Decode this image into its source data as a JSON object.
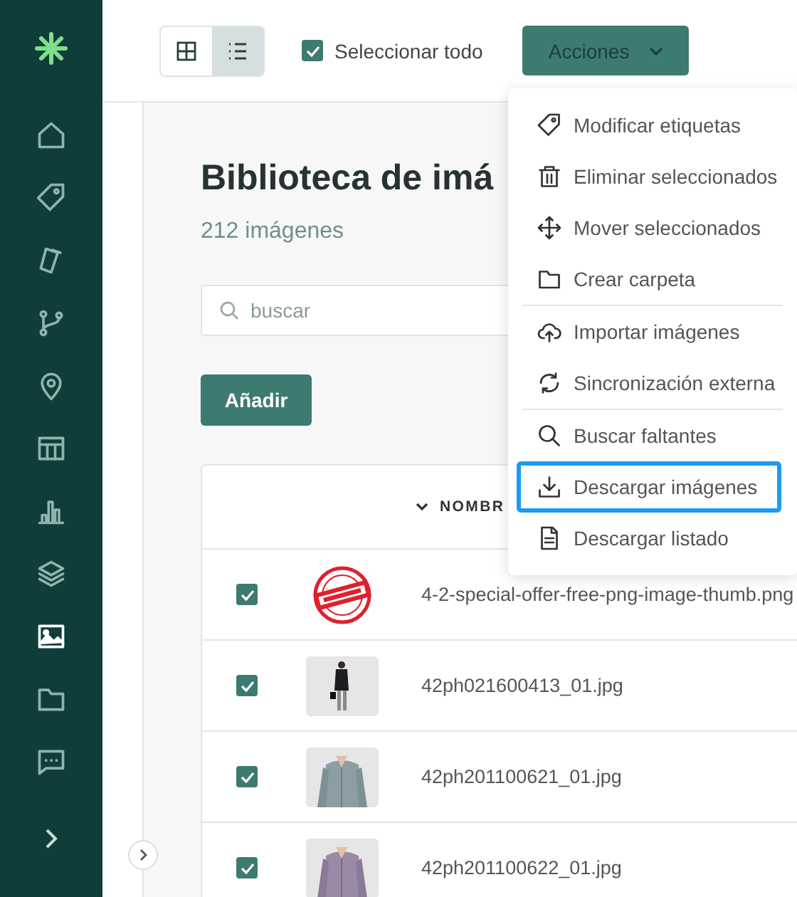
{
  "sidebar": {
    "items": [
      {
        "selected": false
      },
      {
        "selected": false
      },
      {
        "selected": false
      },
      {
        "selected": false
      },
      {
        "selected": false
      },
      {
        "selected": false
      },
      {
        "selected": false
      },
      {
        "selected": false
      },
      {
        "selected": true
      },
      {
        "selected": false
      },
      {
        "selected": false
      }
    ]
  },
  "toolbar": {
    "views": [
      {
        "selected": false
      },
      {
        "selected": true
      }
    ],
    "select_all": {
      "label": "Seleccionar todo",
      "checked": true
    },
    "actions_button": "Acciones"
  },
  "actions_menu": {
    "groups": [
      [
        {
          "label": "Modificar etiquetas",
          "focused": false
        },
        {
          "label": "Eliminar seleccionados",
          "focused": false
        },
        {
          "label": "Mover seleccionados",
          "focused": false
        },
        {
          "label": "Crear carpeta",
          "focused": false
        }
      ],
      [
        {
          "label": "Importar imágenes",
          "focused": false
        },
        {
          "label": "Sincronización externa",
          "focused": false
        }
      ],
      [
        {
          "label": "Buscar faltantes",
          "focused": false
        },
        {
          "label": "Descargar imágenes",
          "focused": true
        },
        {
          "label": "Descargar listado",
          "focused": false
        }
      ]
    ]
  },
  "page": {
    "title": "Biblioteca de imá",
    "count": "212 imágenes",
    "search": {
      "placeholder": "buscar"
    },
    "add_button": "Añadir"
  },
  "table": {
    "column_header": "NOMBR",
    "rows": [
      {
        "checked": true,
        "filename": "4-2-special-offer-free-png-image-thumb.png"
      },
      {
        "checked": true,
        "filename": "42ph021600413_01.jpg"
      },
      {
        "checked": true,
        "filename": "42ph201100621_01.jpg"
      },
      {
        "checked": true,
        "filename": "42ph201100622_01.jpg"
      }
    ]
  }
}
